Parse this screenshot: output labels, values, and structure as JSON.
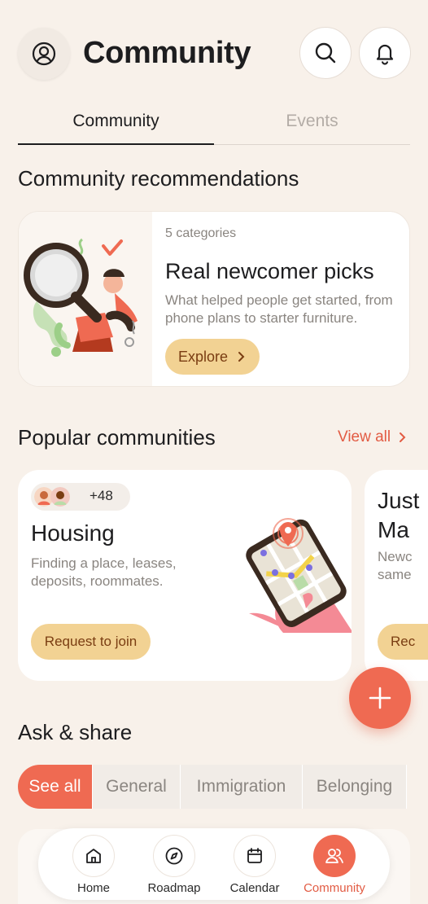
{
  "header": {
    "title": "Community"
  },
  "tabs": [
    {
      "label": "Community",
      "active": true
    },
    {
      "label": "Events",
      "active": false
    }
  ],
  "recommendations": {
    "section_title": "Community recommendations",
    "card": {
      "category_count": "5 categories",
      "title": "Real newcomer picks",
      "description": "What helped people get started, from phone plans to starter furniture.",
      "button_label": "Explore"
    }
  },
  "popular": {
    "section_title": "Popular communities",
    "view_all_label": "View all",
    "cards": [
      {
        "member_count": "+48",
        "name": "Housing",
        "description": "Finding a place, leases, deposits, roommates.",
        "button_label": "Request to join"
      },
      {
        "name_line1": "Just",
        "name_line2": "Ma",
        "desc_line1": "Newc",
        "desc_line2": "same",
        "button_label": "Rec"
      }
    ]
  },
  "ask_share": {
    "section_title": "Ask & share",
    "chips": [
      {
        "label": "See all",
        "active": true
      },
      {
        "label": "General",
        "active": false
      },
      {
        "label": "Immigration",
        "active": false
      },
      {
        "label": "Belonging",
        "active": false
      }
    ]
  },
  "bottom_nav": [
    {
      "label": "Home",
      "icon": "home-icon",
      "active": false
    },
    {
      "label": "Roadmap",
      "icon": "compass-icon",
      "active": false
    },
    {
      "label": "Calendar",
      "icon": "calendar-icon",
      "active": false
    },
    {
      "label": "Community",
      "icon": "people-icon",
      "active": true
    }
  ],
  "colors": {
    "background": "#f8f1ea",
    "accent": "#ef6a52",
    "button_yellow": "#f2d293",
    "button_text": "#7a3d12"
  }
}
